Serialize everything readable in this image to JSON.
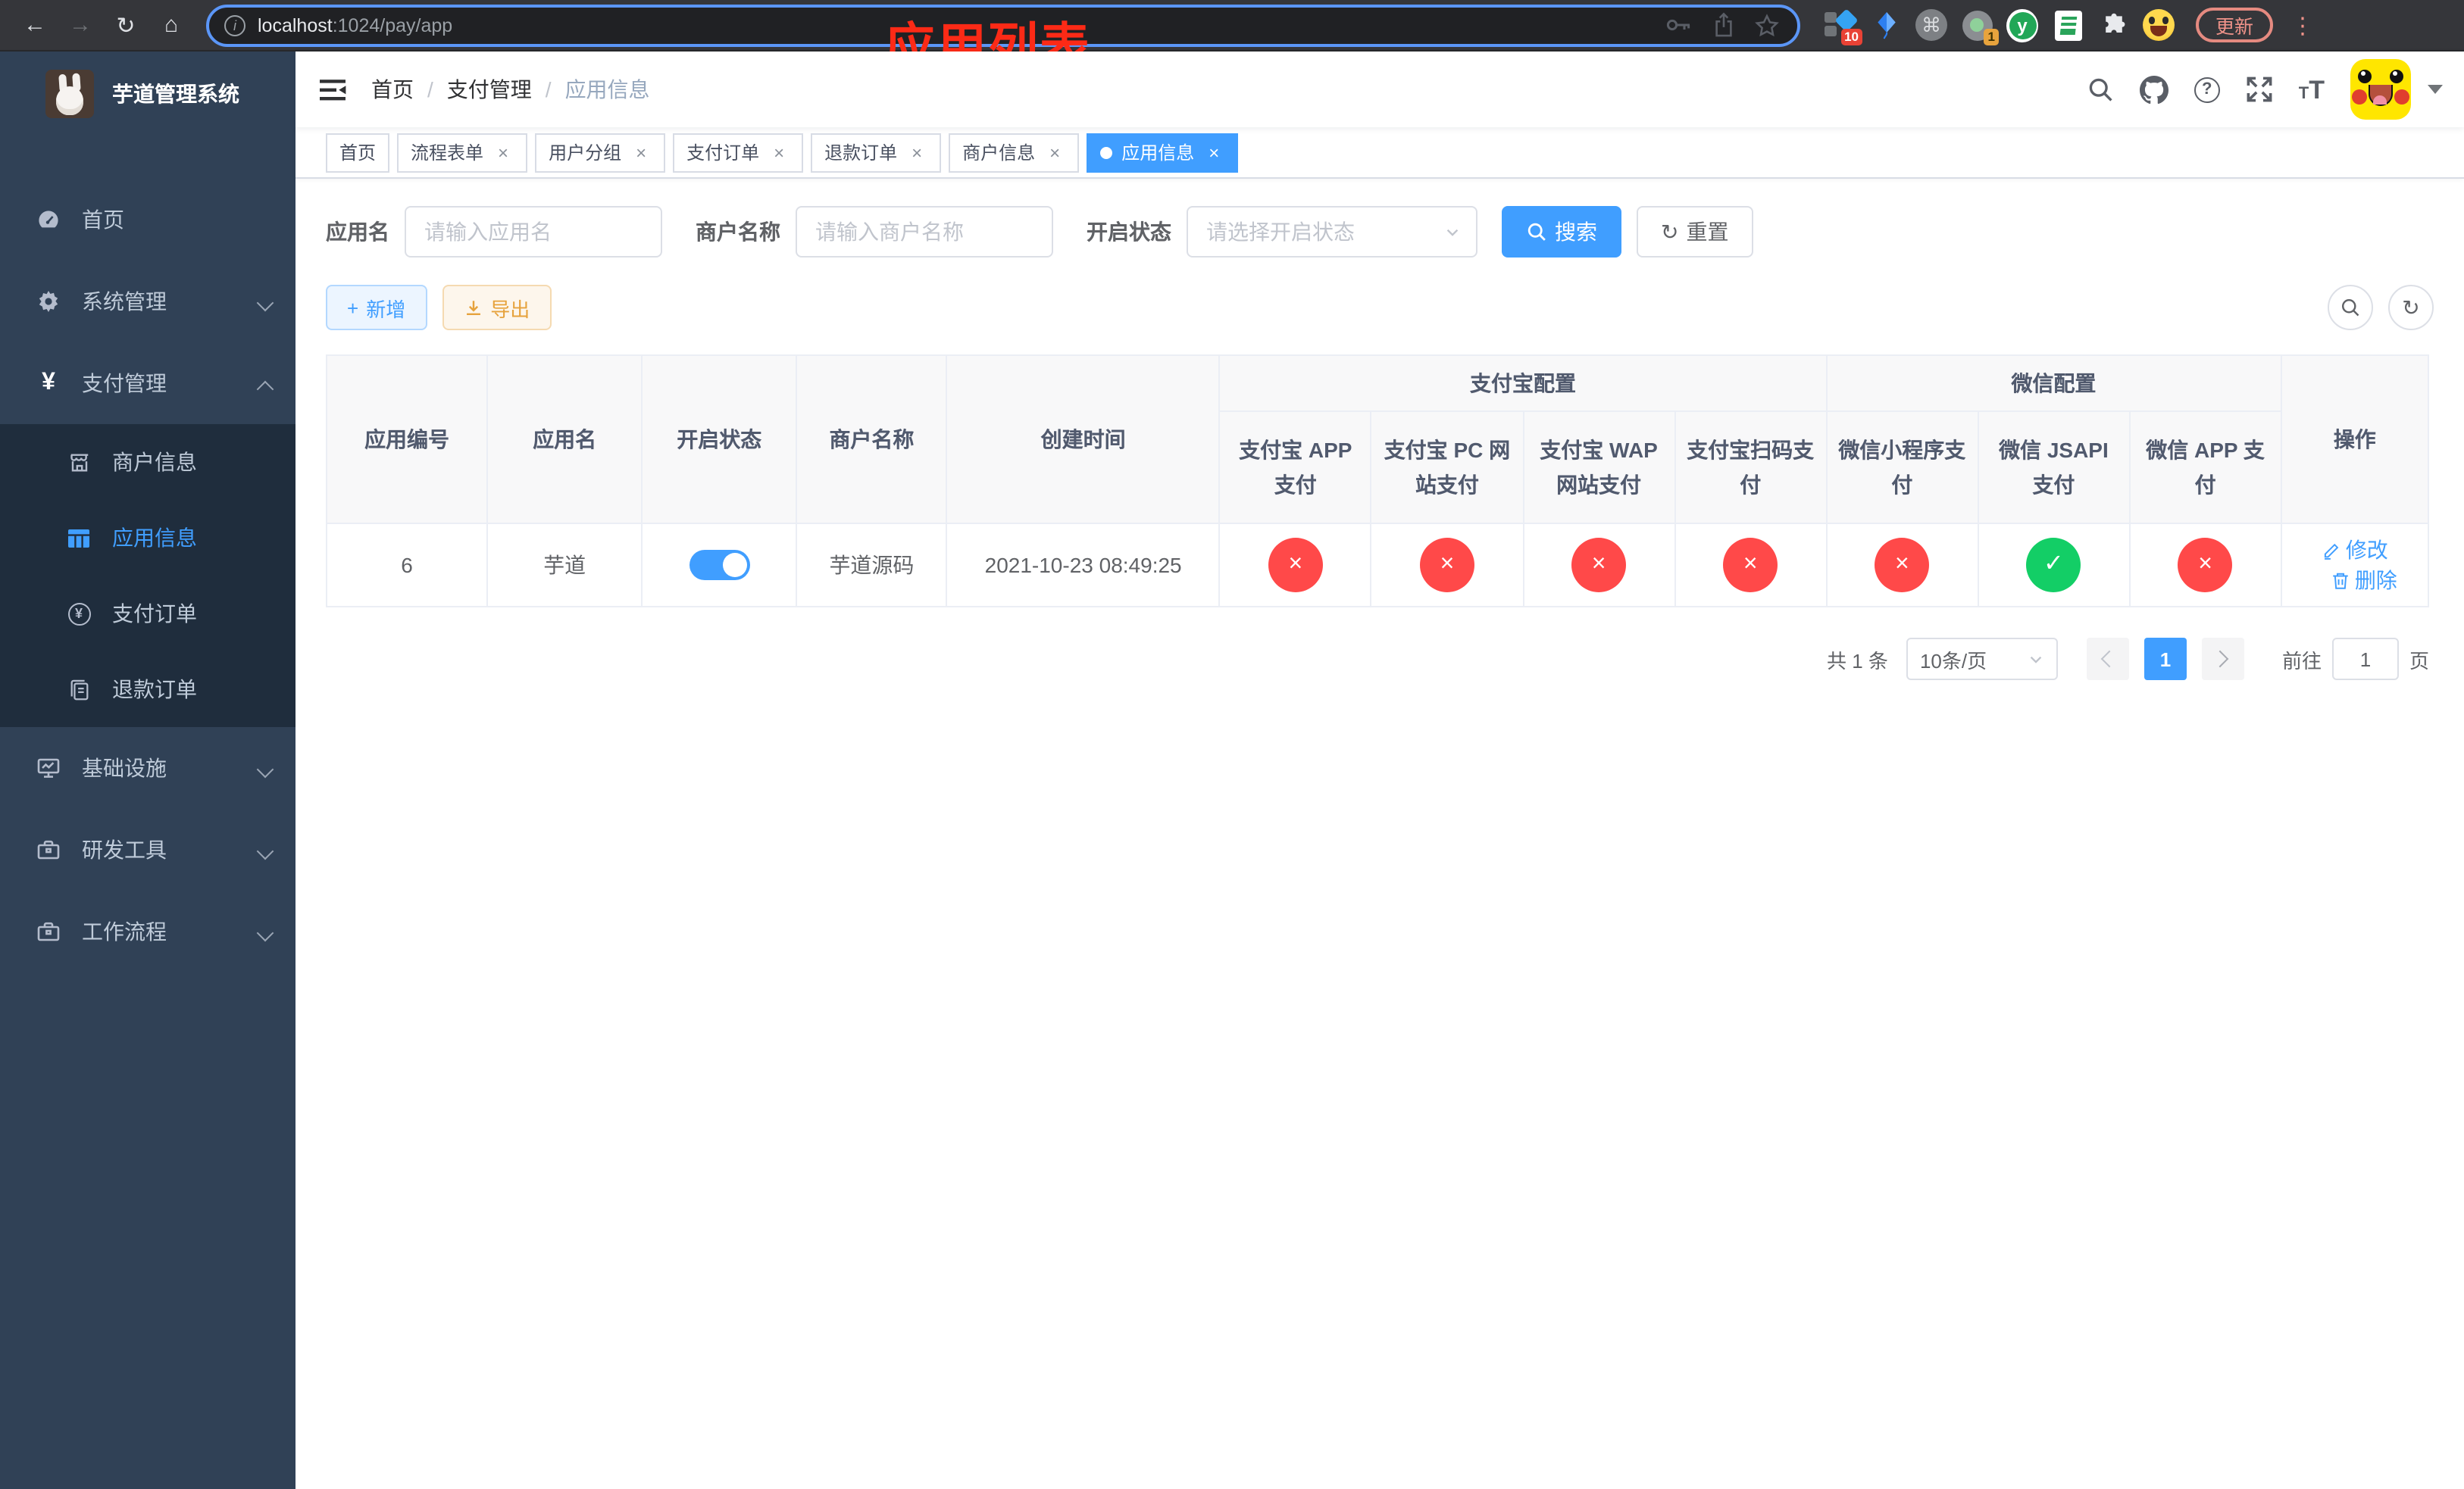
{
  "icons": {
    "close": "×",
    "check": "✓",
    "cross": "×",
    "slash": "/",
    "plus": "+",
    "refresh": "↻",
    "more": "⋮",
    "command": "⌘",
    "question": "?",
    "yen": "¥",
    "back": "←",
    "forward": "→",
    "reload": "↻",
    "home": "⌂",
    "info": "i",
    "y_letter": "y"
  },
  "browser": {
    "url_host": "localhost",
    "url_path": ":1024/pay/app",
    "update_label": "更新",
    "ext_badge_blue": "10",
    "ext_badge_tray": "1"
  },
  "sidebar": {
    "title": "芋道管理系统",
    "menu_home": "首页",
    "menu_system": "系统管理",
    "menu_pay": "支付管理",
    "menu_infra": "基础设施",
    "menu_dev": "研发工具",
    "menu_flow": "工作流程",
    "sub_merchant": "商户信息",
    "sub_app": "应用信息",
    "sub_order": "支付订单",
    "sub_refund": "退款订单"
  },
  "header": {
    "breadcrumb_1": "首页",
    "breadcrumb_2": "支付管理",
    "breadcrumb_3": "应用信息",
    "annotation": "应用列表"
  },
  "tags": [
    {
      "label": "首页",
      "closable": false,
      "active": false
    },
    {
      "label": "流程表单",
      "closable": true,
      "active": false
    },
    {
      "label": "用户分组",
      "closable": true,
      "active": false
    },
    {
      "label": "支付订单",
      "closable": true,
      "active": false
    },
    {
      "label": "退款订单",
      "closable": true,
      "active": false
    },
    {
      "label": "商户信息",
      "closable": true,
      "active": false
    },
    {
      "label": "应用信息",
      "closable": true,
      "active": true
    }
  ],
  "filter": {
    "app_name_label": "应用名",
    "app_name_placeholder": "请输入应用名",
    "merchant_label": "商户名称",
    "merchant_placeholder": "请输入商户名称",
    "status_label": "开启状态",
    "status_placeholder": "请选择开启状态",
    "search": "搜索",
    "reset": "重置"
  },
  "toolbar": {
    "add": "新增",
    "export": "导出"
  },
  "table": {
    "columns": {
      "app_id": "应用编号",
      "app_name": "应用名",
      "status": "开启状态",
      "merchant": "商户名称",
      "created": "创建时间",
      "alipay_group": "支付宝配置",
      "wechat_group": "微信配置",
      "sub": [
        "支付宝 APP 支付",
        "支付宝 PC 网站支付",
        "支付宝 WAP 网站支付",
        "支付宝扫码支付",
        "微信小程序支付",
        "微信 JSAPI 支付",
        "微信 APP 支付"
      ],
      "actions": "操作"
    },
    "row": {
      "app_id": "6",
      "app_name": "芋道",
      "status_on": true,
      "merchant": "芋道源码",
      "created": "2021-10-23 08:49:25",
      "channels": [
        "no",
        "no",
        "no",
        "no",
        "no",
        "yes",
        "no"
      ],
      "edit": "修改",
      "delete": "删除"
    }
  },
  "pagination": {
    "total": "共 1 条",
    "page_size": "10条/页",
    "current": "1",
    "goto_label": "前往",
    "goto_value": "1",
    "page_unit": "页"
  }
}
